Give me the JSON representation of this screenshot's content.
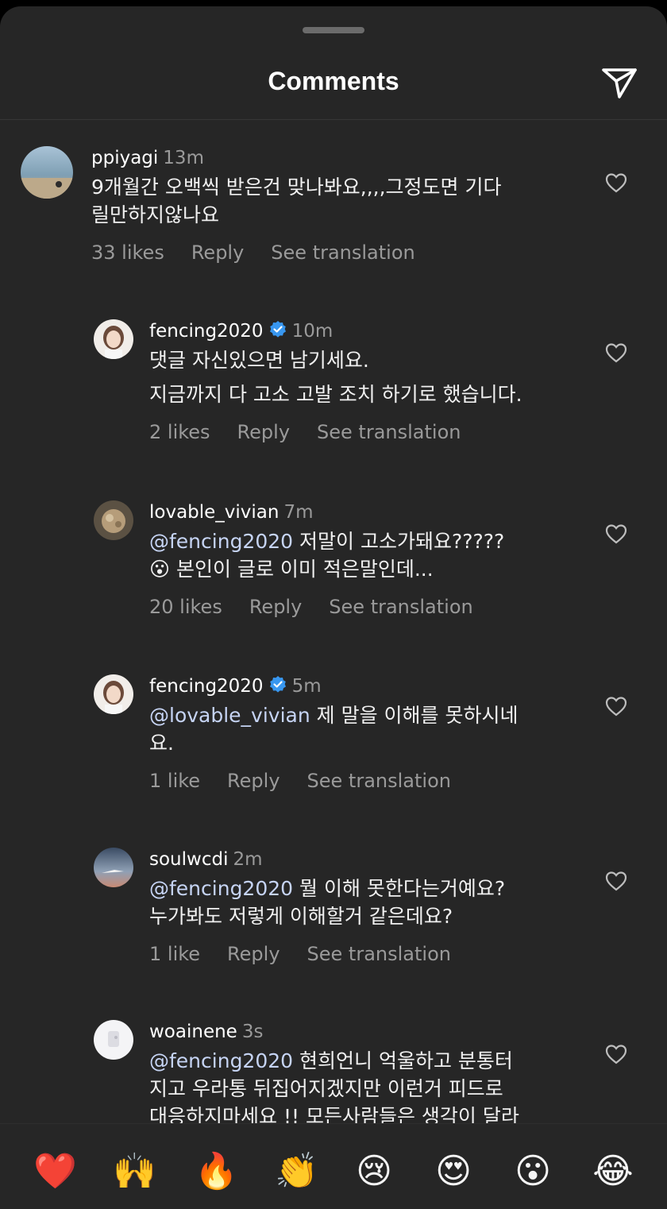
{
  "header": {
    "title": "Comments"
  },
  "comments": [
    {
      "username": "ppiyagi",
      "time": "13m",
      "text_lines": [
        "9개월간 오백씩 받은건 맞나봐요,,,,그정도면 기다",
        "릴만하지않나요"
      ],
      "likes": "33 likes",
      "reply": "Reply",
      "translate": "See translation"
    },
    {
      "username": "fencing2020",
      "verified": true,
      "time": "10m",
      "text_lines": [
        "댓글 자신있으면 남기세요.",
        "지금까지 다 고소 고발 조치 하기로 했습니다."
      ],
      "likes": "2 likes",
      "reply": "Reply",
      "translate": "See translation"
    },
    {
      "username": "lovable_vivian",
      "time": "7m",
      "mention": "@fencing2020",
      "text_first_rest": " 저말이 고소가돼요?????",
      "text_line2": " 본인이 글로 이미 적은말인데...",
      "emoji": "😮",
      "likes": "20 likes",
      "reply": "Reply",
      "translate": "See translation"
    },
    {
      "username": "fencing2020",
      "verified": true,
      "time": "5m",
      "mention": "@lovable_vivian",
      "text_first_rest": " 제 말을 이해를 못하시네",
      "text_line2": "요.",
      "likes": "1 like",
      "reply": "Reply",
      "translate": "See translation"
    },
    {
      "username": "soulwcdi",
      "time": "2m",
      "mention": "@fencing2020",
      "text_first_rest": " 뭘 이해 못한다는거예요?",
      "text_line2": "누가봐도 저렇게 이해할거 같은데요?",
      "likes": "1 like",
      "reply": "Reply",
      "translate": "See translation"
    },
    {
      "username": "woainene",
      "time": "3s",
      "mention": "@fencing2020",
      "text_first_rest": " 현희언니 억울하고 분통터",
      "text_line2": "지고 우라통 뒤집어지겠지만 이런거 피드로",
      "text_line3": "대응하지마세요 !! 모든사람들은  생각이 달라"
    }
  ],
  "emoji_bar": [
    "❤️",
    "🙌",
    "🔥",
    "👏",
    "😢",
    "😍",
    "😮",
    "😂"
  ],
  "colors": {
    "background": "#262626",
    "verified": "#3897f0",
    "mention": "#c6d4f4",
    "muted": "#9a9a9a"
  }
}
